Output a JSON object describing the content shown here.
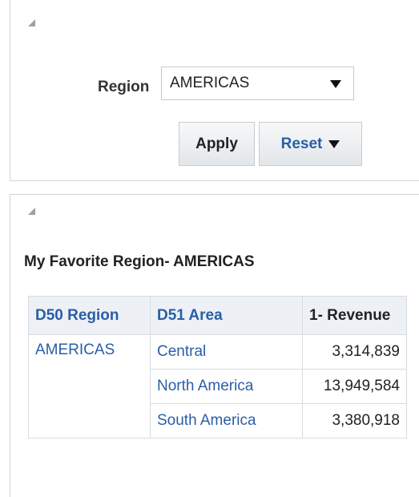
{
  "prompt": {
    "region_label": "Region",
    "region_value": "AMERICAS",
    "apply_label": "Apply",
    "reset_label": "Reset"
  },
  "result": {
    "title": "My Favorite Region- AMERICAS",
    "table": {
      "headers": [
        "D50 Region",
        "D51 Area",
        "1- Revenue"
      ],
      "region": "AMERICAS",
      "rows": [
        {
          "area": "Central",
          "revenue": "3,314,839"
        },
        {
          "area": "North America",
          "revenue": "13,949,584"
        },
        {
          "area": "South America",
          "revenue": "3,380,918"
        }
      ]
    }
  },
  "colors": {
    "link": "#2a5ea6",
    "header_bg": "#edf1f6",
    "border": "#cfd6dd"
  },
  "icons": [
    "collapse-triangle-icon",
    "dropdown-arrow-icon"
  ]
}
